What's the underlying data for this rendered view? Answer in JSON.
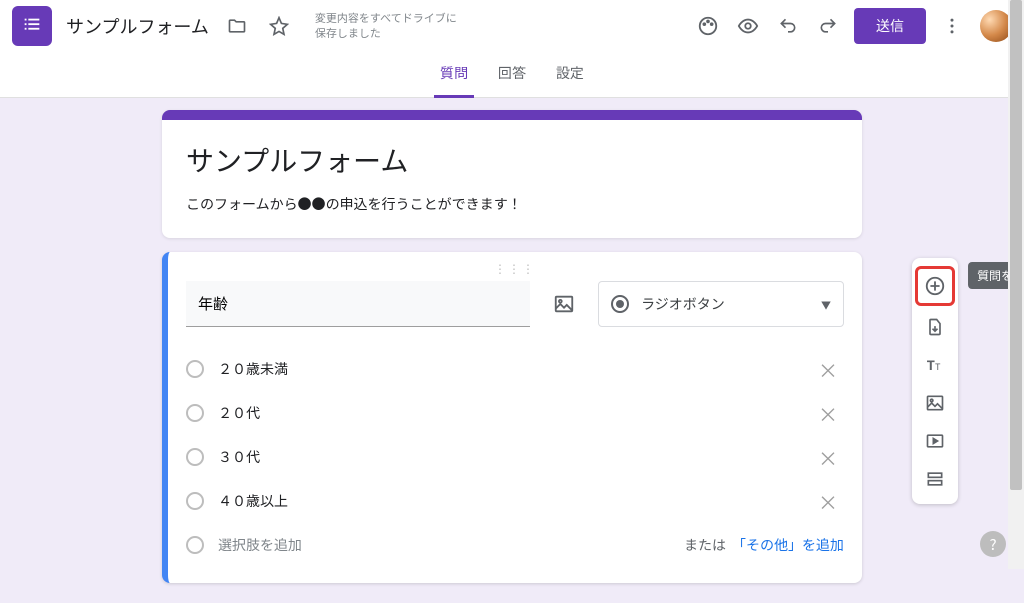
{
  "header": {
    "title": "サンプルフォーム",
    "save_status": "変更内容をすべてドライブに保存しました",
    "send_label": "送信"
  },
  "tabs": {
    "questions": "質問",
    "responses": "回答",
    "settings": "設定"
  },
  "form": {
    "name": "サンプルフォーム",
    "description": "このフォームから●●の申込を行うことができます！"
  },
  "question": {
    "title": "年齢",
    "type_label": "ラジオボタン",
    "options": [
      "２０歳未満",
      "２０代",
      "３０代",
      "４０歳以上"
    ],
    "add_option": "選択肢を追加",
    "or": "または",
    "add_other": "「その他」を追加"
  },
  "tooltip": "質問を追加"
}
